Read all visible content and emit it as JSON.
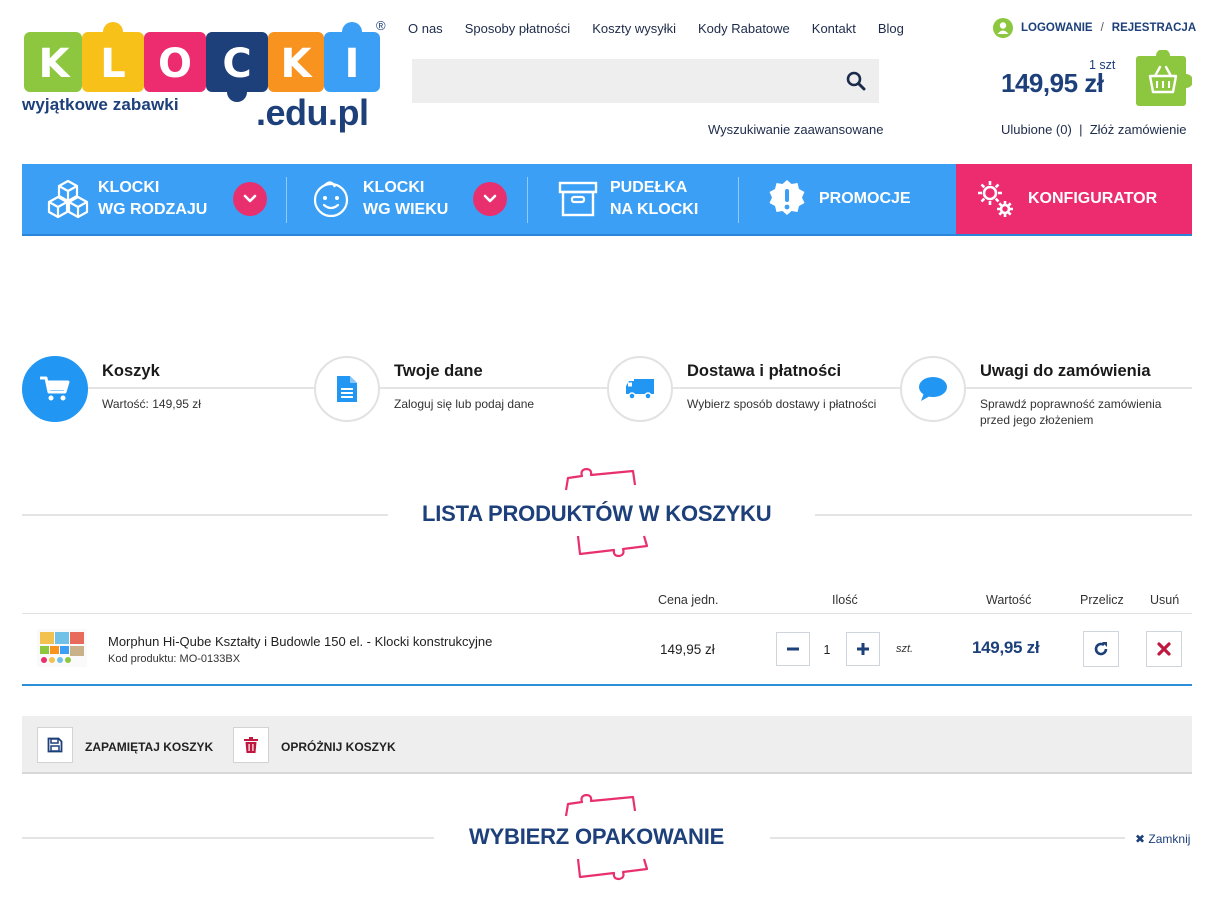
{
  "brand": {
    "logo_letters": [
      "K",
      "L",
      "O",
      "C",
      "K",
      "I"
    ],
    "tagline": "wyjątkowe zabawki",
    "domain": ".edu.pl",
    "registered": "®",
    "colors": {
      "navy": "#1d3f7a",
      "blue": "#3b9ff5",
      "pink": "#ec2c6e",
      "green": "#8dc63f"
    }
  },
  "topnav": [
    "O nas",
    "Sposoby płatności",
    "Koszty wysyłki",
    "Kody Rabatowe",
    "Kontakt",
    "Blog"
  ],
  "search": {
    "placeholder": "",
    "icon": "search-icon",
    "advanced_label": "Wyszukiwanie zaawansowane"
  },
  "account": {
    "login": "LOGOWANIE",
    "separator": "/",
    "register": "REJESTRACJA"
  },
  "cart": {
    "qty": "1 szt",
    "sum": "149,95 zł",
    "favorites": "Ulubione (0)",
    "sep": "|",
    "order": "Złóż zamówienie"
  },
  "categories": [
    {
      "line1": "KLOCKI",
      "line2": "WG RODZAJU",
      "icon": "cubes-icon"
    },
    {
      "line1": "KLOCKI",
      "line2": "WG WIEKU",
      "icon": "baby-face-icon"
    },
    {
      "line1": "PUDEŁKA",
      "line2": "NA KLOCKI",
      "icon": "box-icon"
    },
    {
      "line1": "PROMOCJE",
      "line2": "",
      "icon": "promo-badge-icon"
    },
    {
      "line1": "KONFIGURATOR",
      "line2": "",
      "icon": "gears-icon"
    }
  ],
  "steps": [
    {
      "title": "Koszyk",
      "desc": "Wartość: 149,95 zł",
      "icon": "cart-icon",
      "active": true
    },
    {
      "title": "Twoje dane",
      "desc": "Zaloguj się lub podaj dane",
      "icon": "document-icon"
    },
    {
      "title": "Dostawa i płatności",
      "desc": "Wybierz sposób dostawy i płatności",
      "icon": "truck-icon"
    },
    {
      "title": "Uwagi do zamówienia",
      "desc1": "Sprawdź poprawność zamówienia",
      "desc2": "przed jego złożeniem",
      "icon": "chat-bubble-icon"
    }
  ],
  "list_title": "LISTA PRODUKTÓW W KOSZYKU",
  "table": {
    "headers": {
      "unit_price": "Cena jedn.",
      "qty": "Ilość",
      "value": "Wartość",
      "recalc": "Przelicz",
      "remove": "Usuń"
    },
    "rows": [
      {
        "name": "Morphun Hi-Qube Kształty i Budowle 150 el. - Klocki konstrukcyjne",
        "code": "Kod produktu: MO-0133BX",
        "unit_price": "149,95 zł",
        "qty": "1",
        "unit": "szt.",
        "total": "149,95 zł"
      }
    ]
  },
  "cart_actions": {
    "save": "ZAPAMIĘTAJ KOSZYK",
    "clear": "OPRÓŻNIJ KOSZYK"
  },
  "packaging_title": "WYBIERZ OPAKOWANIE",
  "close_label": "Zamknij",
  "close_glyph": "✖"
}
